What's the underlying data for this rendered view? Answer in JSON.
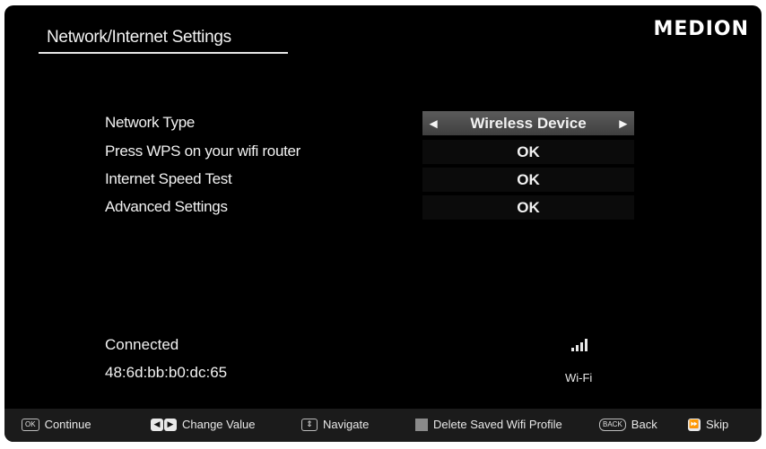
{
  "header": {
    "title": "Network/Internet Settings",
    "logo": "MEDION"
  },
  "settings": [
    {
      "label": "Network Type",
      "value": "Wireless Device",
      "selectable": true
    },
    {
      "label": "Press WPS on your wifi router",
      "value": "OK"
    },
    {
      "label": "Internet Speed Test",
      "value": "OK"
    },
    {
      "label": "Advanced Settings",
      "value": "OK"
    }
  ],
  "status": {
    "connection": "Connected",
    "mac": "48:6d:bb:b0:dc:65",
    "wifi_label": "Wi-Fi",
    "signal_bars": 4
  },
  "footer": {
    "ok_key": "OK",
    "continue": "Continue",
    "change_value": "Change Value",
    "navigate": "Navigate",
    "delete_profile": "Delete Saved Wifi Profile",
    "back_key": "BACK",
    "back": "Back",
    "skip": "Skip"
  },
  "icons": {
    "left_arrow": "left-arrow-icon",
    "right_arrow": "right-arrow-icon",
    "wifi": "wifi-signal-icon"
  },
  "colors": {
    "background": "#000000",
    "selected": "#4a4a4a",
    "footer": "#1b1b1b"
  }
}
